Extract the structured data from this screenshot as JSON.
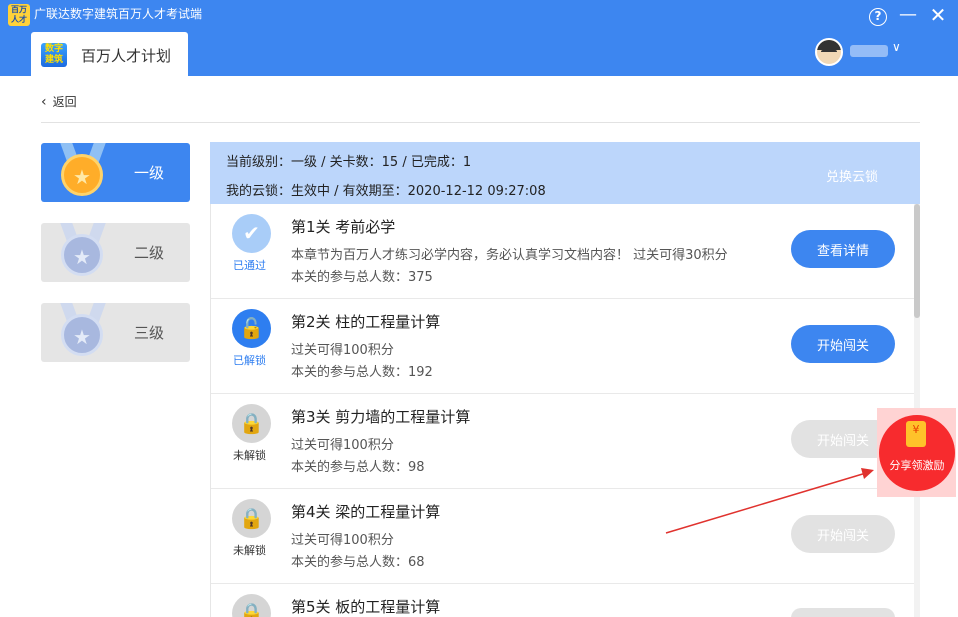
{
  "window": {
    "title": "广联达数字建筑百万人才考试端",
    "app_icon_text": "百万人才",
    "help_icon": "?",
    "minimize_icon": "—",
    "close_icon": "✕"
  },
  "tab": {
    "label": "百万人才计划",
    "logo_text": "数字建筑"
  },
  "user": {
    "chevron": "∨"
  },
  "back": {
    "icon": "‹",
    "label": "返回"
  },
  "levels": [
    {
      "label": "一级",
      "active": true
    },
    {
      "label": "二级",
      "active": false
    },
    {
      "label": "三级",
      "active": false
    }
  ],
  "info": {
    "line1": "当前级别：一级  /  关卡数：15  /  已完成：1",
    "line2": "我的云锁：生效中 / 有效期至：2020-12-12 09:27:08",
    "exchange": "兑换云锁"
  },
  "stages": [
    {
      "title": "第1关 考前必学",
      "desc": "本章节为百万人才练习必学内容，务必认真学习文档内容！ 过关可得30积分",
      "count": "本关的参与总人数：375",
      "status": "已通过",
      "button": "查看详情",
      "icon": "✔"
    },
    {
      "title": "第2关 柱的工程量计算",
      "desc": "过关可得100积分",
      "count": "本关的参与总人数：192",
      "status": "已解锁",
      "button": "开始闯关",
      "icon": "🔓"
    },
    {
      "title": "第3关 剪力墙的工程量计算",
      "desc": "过关可得100积分",
      "count": "本关的参与总人数：98",
      "status": "未解锁",
      "button": "开始闯关",
      "icon": "🔒"
    },
    {
      "title": "第4关 梁的工程量计算",
      "desc": "过关可得100积分",
      "count": "本关的参与总人数：68",
      "status": "未解锁",
      "button": "开始闯关",
      "icon": "🔒"
    },
    {
      "title": "第5关 板的工程量计算",
      "icon": "🔒"
    }
  ],
  "share": {
    "label": "分享领激励",
    "icon": "¥"
  },
  "colors": {
    "accent": "#3d86f0",
    "share_red": "#f72b2e",
    "arrow": "#e0322e"
  }
}
